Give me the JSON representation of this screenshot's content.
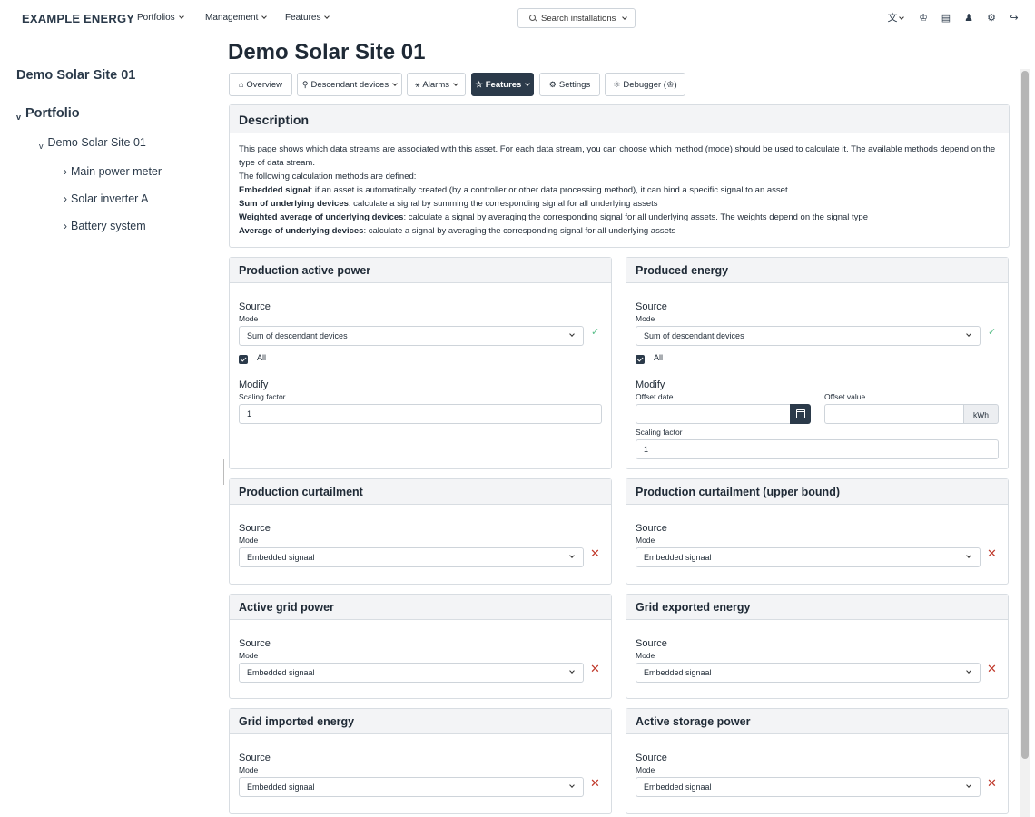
{
  "nav": {
    "brand": "EXAMPLE ENERGY",
    "menus": [
      "Portfolios",
      "Management",
      "Features"
    ],
    "search_label": "Search installations",
    "tool_icons": [
      "translate-icon",
      "crown-icon",
      "book-icon",
      "user-icon",
      "gear-icon",
      "logout-icon"
    ]
  },
  "sidebar": {
    "title": "Demo Solar Site 01",
    "root": "Portfolio",
    "site": "Demo Solar Site 01",
    "children": [
      "Main power meter",
      "Solar inverter A",
      "Battery system"
    ]
  },
  "page": {
    "title": "Demo Solar Site 01",
    "tabs": [
      "Overview",
      "Descendant devices",
      "Alarms",
      "Features",
      "Settings",
      "Debugger (♔)"
    ],
    "active_tab": "Features"
  },
  "description": {
    "heading": "Description",
    "intro": "This page shows which data streams are associated with this asset. For each data stream, you can choose which method (mode) should be used to calculate it. The available methods depend on the type of data stream.",
    "methods_intro": "The following calculation methods are defined:",
    "methods": [
      {
        "term": "Embedded signal",
        "text": ": if an asset is automatically created (by a controller or other data processing method), it can bind a specific signal to an asset"
      },
      {
        "term": "Sum of underlying devices",
        "text": ": calculate a signal by summing the corresponding signal for all underlying assets"
      },
      {
        "term": "Weighted average of underlying devices",
        "text": ": calculate a signal by averaging the corresponding signal for all underlying assets. The weights depend on the signal type"
      },
      {
        "term": "Average of underlying devices",
        "text": ": calculate a signal by averaging the corresponding signal for all underlying assets"
      }
    ]
  },
  "labels": {
    "source": "Source",
    "mode": "Mode",
    "modify": "Modify",
    "scaling_factor": "Scaling factor",
    "offset_date": "Offset date",
    "offset_value": "Offset value",
    "all": "All"
  },
  "features": {
    "production_active_power": {
      "title": "Production active power",
      "mode": "Sum of descendant devices",
      "all_checked": true,
      "scaling_factor": "1"
    },
    "produced_energy": {
      "title": "Produced energy",
      "mode": "Sum of descendant devices",
      "all_checked": true,
      "offset_date": "",
      "offset_value": "",
      "unit": "kWh",
      "scaling_factor": "1"
    },
    "production_curtailment": {
      "title": "Production curtailment",
      "mode": "Embedded signaal"
    },
    "production_curtailment_upper": {
      "title": "Production curtailment (upper bound)",
      "mode": "Embedded signaal"
    },
    "active_grid_power": {
      "title": "Active grid power",
      "mode": "Embedded signaal"
    },
    "grid_exported_energy": {
      "title": "Grid exported energy",
      "mode": "Embedded signaal"
    },
    "grid_imported_energy": {
      "title": "Grid imported energy",
      "mode": "Embedded signaal"
    },
    "active_storage_power": {
      "title": "Active storage power",
      "mode": "Embedded signaal"
    }
  },
  "colors": {
    "primary": "#2b3a4a",
    "success": "#5bbf8a",
    "danger": "#c0392b",
    "card_header": "#f3f4f6"
  }
}
